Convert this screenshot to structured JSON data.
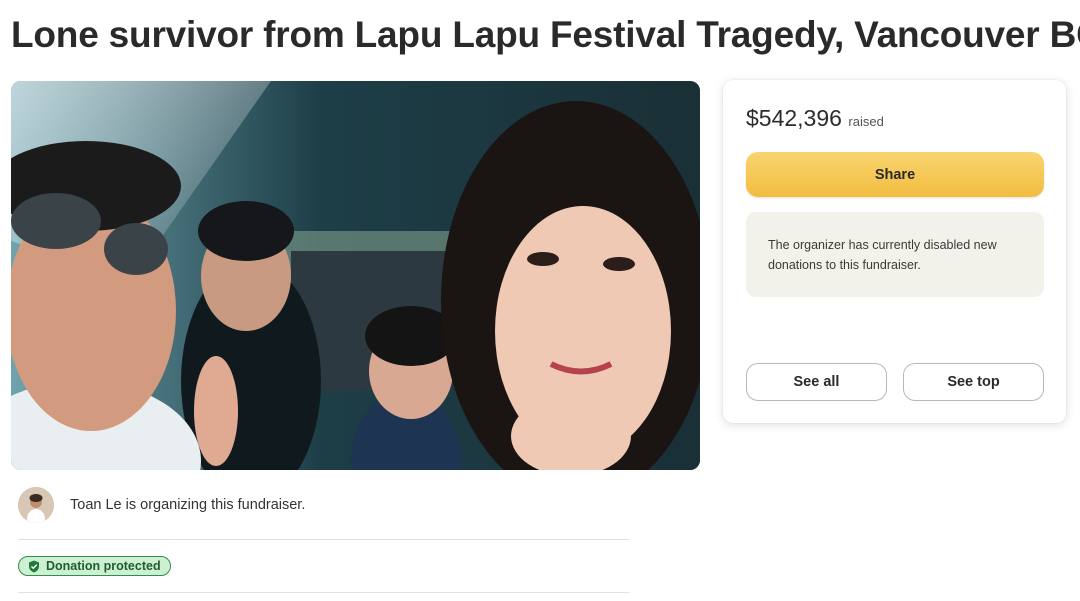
{
  "campaign": {
    "title": "Lone survivor from Lapu Lapu Festival Tragedy, Vancouver BC"
  },
  "organizer": {
    "text": "Toan Le is organizing this fundraiser."
  },
  "badge": {
    "label": "Donation protected",
    "icon": "shield-check-icon"
  },
  "donation_card": {
    "amount": "$542,396",
    "raised_label": "raised",
    "share_label": "Share",
    "notice": "The organizer has currently disabled new donations to this fundraiser.",
    "see_all_label": "See all",
    "see_top_label": "See top"
  },
  "colors": {
    "share_button": "#f2bd3f",
    "badge_bg": "#cdf0d2",
    "badge_border": "#2f8f48"
  }
}
